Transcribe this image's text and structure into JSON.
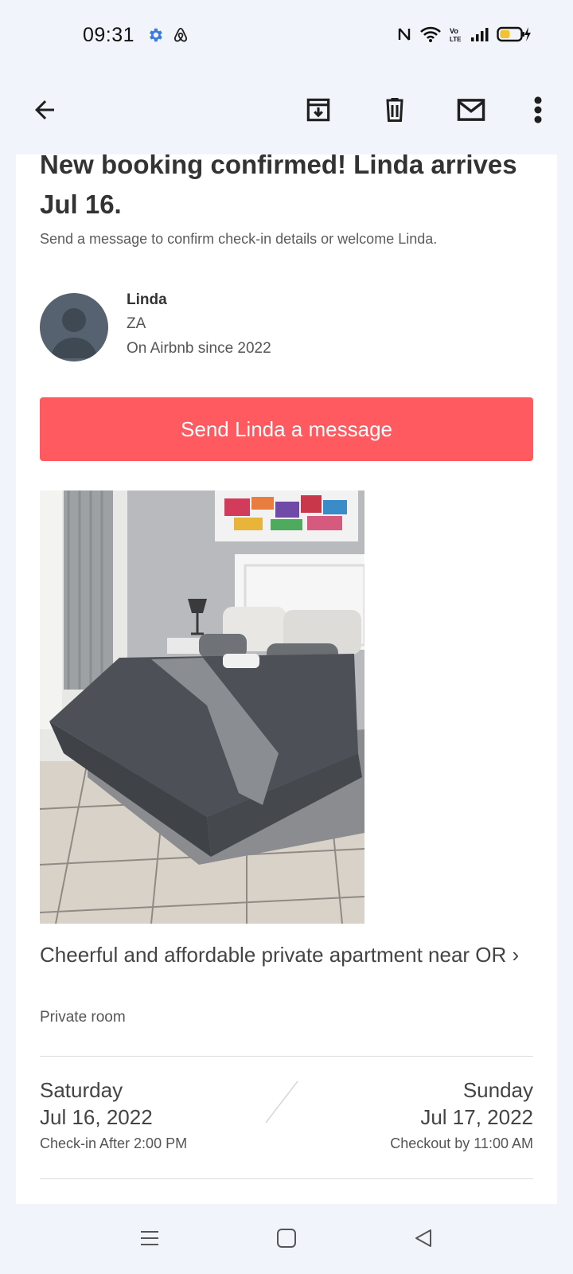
{
  "status_bar": {
    "time": "09:31",
    "left_icons": [
      "gear-icon",
      "airbnb-icon"
    ],
    "right_icons": [
      "nfc-icon",
      "wifi-icon",
      "volte-icon",
      "signal-icon",
      "battery-charging-icon"
    ]
  },
  "app_bar": {
    "icons": [
      "back-arrow-icon",
      "archive-icon",
      "delete-icon",
      "mail-icon",
      "more-vert-icon"
    ]
  },
  "email": {
    "headline": "New booking confirmed! Linda arrives Jul 16.",
    "subline": "Send a message to confirm check-in details or welcome Linda.",
    "guest": {
      "name": "Linda",
      "country": "ZA",
      "since": "On Airbnb since 2022"
    },
    "message_button": "Send Linda a message",
    "listing": {
      "title": "Cheerful and affordable private apartment near OR ›",
      "type": "Private room"
    },
    "checkin": {
      "day": "Saturday",
      "date": "Jul 16, 2022",
      "note": "Check-in After 2:00 PM"
    },
    "checkout": {
      "day": "Sunday",
      "date": "Jul 17, 2022",
      "note": "Checkout by 11:00 AM"
    }
  },
  "nav_bar": {
    "icons": [
      "menu-icon",
      "home-square-icon",
      "back-triangle-icon"
    ]
  },
  "colors": {
    "accent": "#ff5a5f",
    "background": "#f1f4fb",
    "card": "#ffffff"
  }
}
